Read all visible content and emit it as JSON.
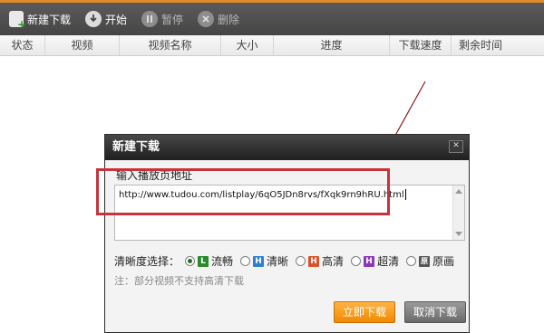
{
  "toolbar": {
    "new_label": "新建下载",
    "start_label": "开始",
    "pause_label": "暂停",
    "delete_label": "删除"
  },
  "table": {
    "headers": [
      "状态",
      "视频",
      "视频名称",
      "大小",
      "进度",
      "下载速度",
      "剩余时间"
    ]
  },
  "dialog": {
    "title": "新建下载",
    "close_glyph": "✕",
    "url_label": "输入播放页地址",
    "url_value": "http://www.tudou.com/listplay/6qO5JDn8rvs/fXqk9rn9hRU.html",
    "quality_label": "清晰度选择：",
    "quality_options": [
      {
        "label": "流畅",
        "badge": "L",
        "badge_color": "#2b8a2b",
        "selected": true
      },
      {
        "label": "清晰",
        "badge": "H",
        "badge_color": "#2d7fd6",
        "selected": false
      },
      {
        "label": "高清",
        "badge": "H",
        "badge_color": "#d9532b",
        "selected": false
      },
      {
        "label": "超清",
        "badge": "H",
        "badge_color": "#8a3ab9",
        "selected": false
      },
      {
        "label": "原画",
        "badge": "原",
        "badge_color": "#555555",
        "selected": false
      }
    ],
    "note": "注：部分视频不支持高清下载",
    "ok_label": "立即下载",
    "cancel_label": "取消下载"
  },
  "colors": {
    "accent_orange": "#f08a00",
    "highlight_red": "#c8323a",
    "toolbar_dark": "#4a4a4a"
  }
}
